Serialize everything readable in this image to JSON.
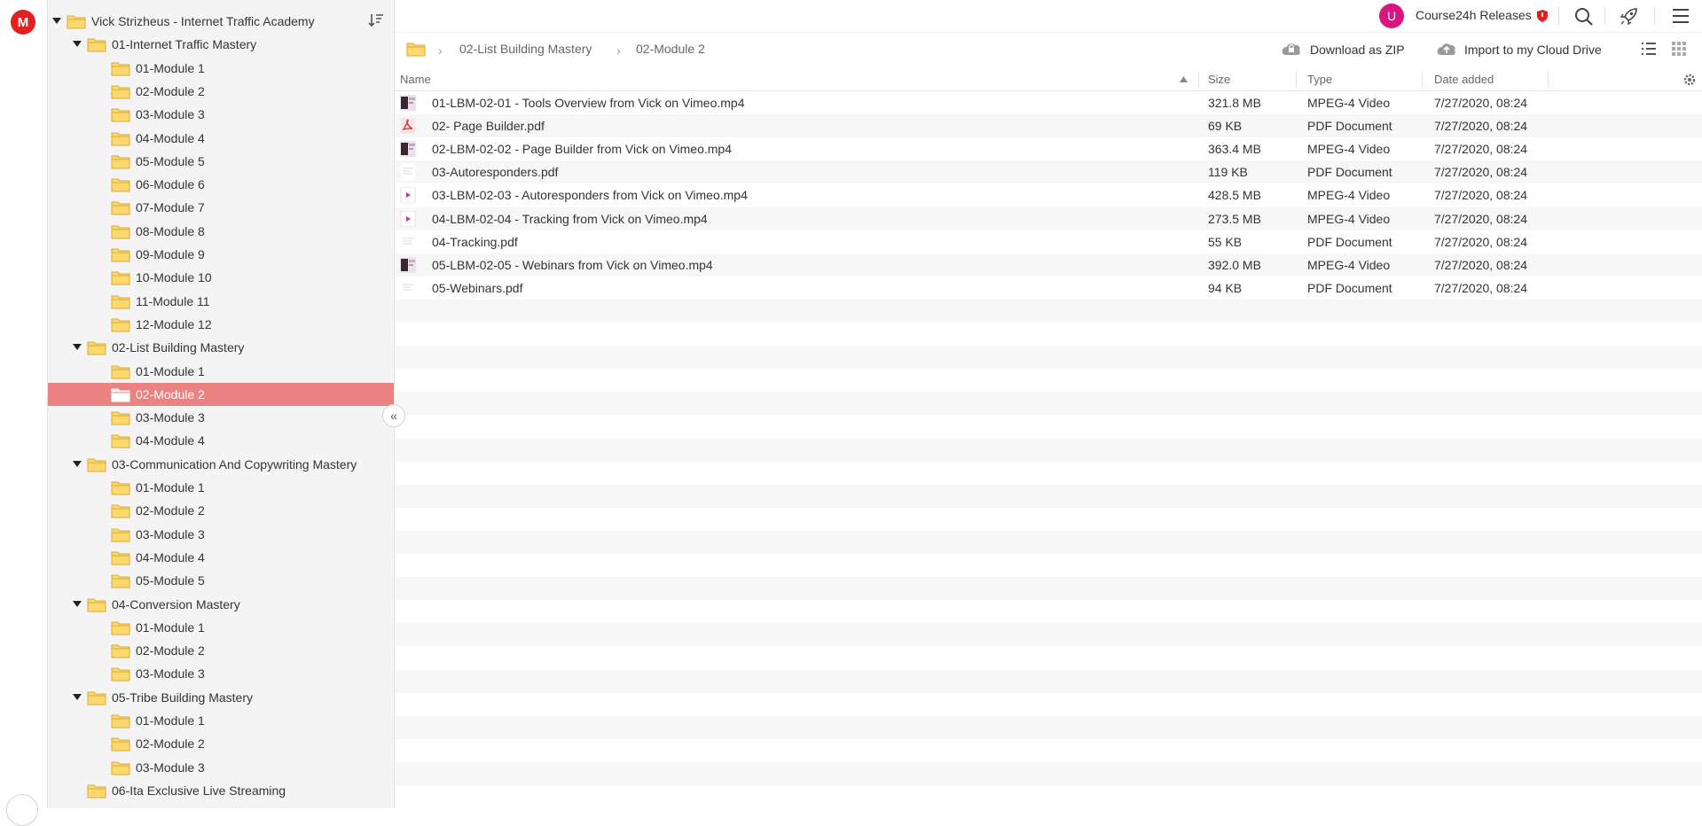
{
  "app": {
    "logo_letter": "M"
  },
  "header": {
    "avatar_letter": "U",
    "account_name": "Course24h Releases"
  },
  "tree": {
    "root": "Vick Strizheus - Internet Traffic Academy",
    "items": [
      {
        "label": "01-Internet Traffic Mastery",
        "level": 1,
        "expanded": true
      },
      {
        "label": "01-Module 1",
        "level": 2
      },
      {
        "label": "02-Module 2",
        "level": 2
      },
      {
        "label": "03-Module 3",
        "level": 2
      },
      {
        "label": "04-Module 4",
        "level": 2
      },
      {
        "label": "05-Module 5",
        "level": 2
      },
      {
        "label": "06-Module 6",
        "level": 2
      },
      {
        "label": "07-Module 7",
        "level": 2
      },
      {
        "label": "08-Module 8",
        "level": 2
      },
      {
        "label": "09-Module 9",
        "level": 2
      },
      {
        "label": "10-Module 10",
        "level": 2
      },
      {
        "label": "11-Module 11",
        "level": 2
      },
      {
        "label": "12-Module 12",
        "level": 2
      },
      {
        "label": "02-List Building Mastery",
        "level": 1,
        "expanded": true
      },
      {
        "label": "01-Module 1",
        "level": 2
      },
      {
        "label": "02-Module 2",
        "level": 2,
        "selected": true
      },
      {
        "label": "03-Module 3",
        "level": 2
      },
      {
        "label": "04-Module 4",
        "level": 2
      },
      {
        "label": "03-Communication And Copywriting Mastery",
        "level": 1,
        "expanded": true
      },
      {
        "label": "01-Module 1",
        "level": 2
      },
      {
        "label": "02-Module 2",
        "level": 2
      },
      {
        "label": "03-Module 3",
        "level": 2
      },
      {
        "label": "04-Module 4",
        "level": 2
      },
      {
        "label": "05-Module 5",
        "level": 2
      },
      {
        "label": "04-Conversion Mastery",
        "level": 1,
        "expanded": true
      },
      {
        "label": "01-Module 1",
        "level": 2
      },
      {
        "label": "02-Module 2",
        "level": 2
      },
      {
        "label": "03-Module 3",
        "level": 2
      },
      {
        "label": "05-Tribe Building Mastery",
        "level": 1,
        "expanded": true
      },
      {
        "label": "01-Module 1",
        "level": 2
      },
      {
        "label": "02-Module 2",
        "level": 2
      },
      {
        "label": "03-Module 3",
        "level": 2
      },
      {
        "label": "06-Ita Exclusive Live Streaming",
        "level": 1,
        "expanded": false
      }
    ]
  },
  "breadcrumb": {
    "items": [
      "02-List Building Mastery",
      "02-Module 2"
    ]
  },
  "actions": {
    "download_zip": "Download as ZIP",
    "import_cloud": "Import to my Cloud Drive"
  },
  "table": {
    "columns": {
      "name": "Name",
      "size": "Size",
      "type": "Type",
      "date": "Date added"
    },
    "rows": [
      {
        "name": "01-LBM-02-01 - Tools Overview from Vick on Vimeo.mp4",
        "size": "321.8 MB",
        "type": "MPEG-4 Video",
        "date": "7/27/2020, 08:24",
        "thumb": "video-thumb"
      },
      {
        "name": "02- Page Builder.pdf",
        "size": "69 KB",
        "type": "PDF Document",
        "date": "7/27/2020, 08:24",
        "thumb": "pdf-icon"
      },
      {
        "name": "02-LBM-02-02 - Page Builder from Vick on Vimeo.mp4",
        "size": "363.4 MB",
        "type": "MPEG-4 Video",
        "date": "7/27/2020, 08:24",
        "thumb": "video-thumb"
      },
      {
        "name": "03-Autoresponders.pdf",
        "size": "119 KB",
        "type": "PDF Document",
        "date": "7/27/2020, 08:24",
        "thumb": "doc-thumb"
      },
      {
        "name": "03-LBM-02-03 - Autoresponders from Vick on Vimeo.mp4",
        "size": "428.5 MB",
        "type": "MPEG-4 Video",
        "date": "7/27/2020, 08:24",
        "thumb": "play-icon"
      },
      {
        "name": "04-LBM-02-04 - Tracking from Vick on Vimeo.mp4",
        "size": "273.5 MB",
        "type": "MPEG-4 Video",
        "date": "7/27/2020, 08:24",
        "thumb": "play-icon"
      },
      {
        "name": "04-Tracking.pdf",
        "size": "55 KB",
        "type": "PDF Document",
        "date": "7/27/2020, 08:24",
        "thumb": "doc-thumb"
      },
      {
        "name": "05-LBM-02-05 - Webinars from Vick on Vimeo.mp4",
        "size": "392.0 MB",
        "type": "MPEG-4 Video",
        "date": "7/27/2020, 08:24",
        "thumb": "video-thumb"
      },
      {
        "name": "05-Webinars.pdf",
        "size": "94 KB",
        "type": "PDF Document",
        "date": "7/27/2020, 08:24",
        "thumb": "doc-thumb"
      }
    ]
  },
  "colors": {
    "accent": "#e31f1f",
    "selected": "#eb8282",
    "folder": "#fdd86c",
    "avatar": "#d9167e"
  }
}
